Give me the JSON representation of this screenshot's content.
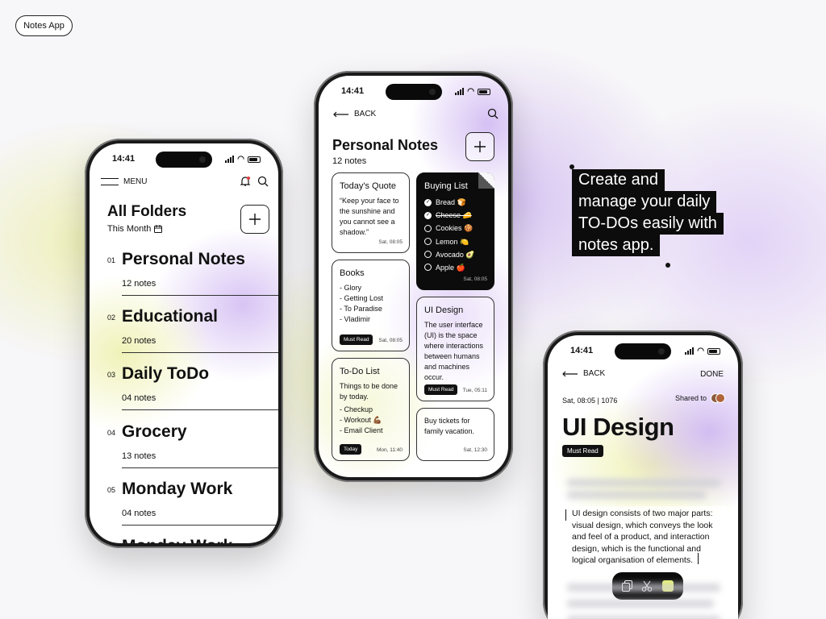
{
  "badge": "Notes App",
  "caption": [
    "Create and",
    "manage your daily",
    "TO-DOs easily with",
    "notes app."
  ],
  "status_time": "14:41",
  "phone1": {
    "menu_label": "MENU",
    "title": "All Folders",
    "subtitle": "This Month",
    "folders": [
      {
        "num": "01",
        "name": "Personal Notes",
        "count": "12 notes"
      },
      {
        "num": "02",
        "name": "Educational",
        "count": "20 notes"
      },
      {
        "num": "03",
        "name": "Daily ToDo",
        "count": "04 notes"
      },
      {
        "num": "04",
        "name": "Grocery",
        "count": "13 notes"
      },
      {
        "num": "05",
        "name": "Monday Work",
        "count": "04 notes"
      }
    ],
    "peek": "Monday Work"
  },
  "phone2": {
    "back_label": "BACK",
    "title": "Personal Notes",
    "subtitle": "12 notes",
    "quote": {
      "title": "Today's Quote",
      "body": "“Keep your face to the sunshine and you cannot see a shadow.”",
      "date": "Sat, 08:05"
    },
    "books": {
      "title": "Books",
      "items": [
        "- Glory",
        "- Getting Lost",
        "- To Paradise",
        "- Vladimir"
      ],
      "tag": "Must Read",
      "date": "Sat, 08:05"
    },
    "todo": {
      "title": "To-Do List",
      "body": "Things to be done by today.",
      "items": [
        "- Checkup",
        "- Workout 💪🏾",
        "- Email Client"
      ],
      "tag": "Today",
      "date": "Mon, 11:40"
    },
    "buying": {
      "title": "Buying List",
      "items": [
        {
          "text": "Bread 🍞",
          "checked": true,
          "strike": false
        },
        {
          "text": "Cheese 🧀",
          "checked": true,
          "strike": true
        },
        {
          "text": "Cookies 🍪",
          "checked": false,
          "strike": false
        },
        {
          "text": "Lemon 🍋",
          "checked": false,
          "strike": false
        },
        {
          "text": "Avocado 🥑",
          "checked": false,
          "strike": false
        },
        {
          "text": "Apple 🍎",
          "checked": false,
          "strike": false
        }
      ],
      "date": "Sat, 08:05"
    },
    "uidesign": {
      "title": "UI Design",
      "body": "The user interface (UI) is the space where interactions between humans and machines occur.",
      "tag": "Must Read",
      "date": "Tue, 05:11"
    },
    "tickets": {
      "body": "Buy tickets for family vacation.",
      "date": "Sat, 12:30"
    }
  },
  "phone3": {
    "back_label": "BACK",
    "done_label": "DONE",
    "meta": "Sat, 08:05 | 1076",
    "shared_label": "Shared to",
    "title": "UI Design",
    "tag": "Must Read",
    "selected_text": "UI design consists of two major parts: visual design, which conveys the look and feel of a product, and interaction design, which is the functional and logical organisation of elements."
  }
}
